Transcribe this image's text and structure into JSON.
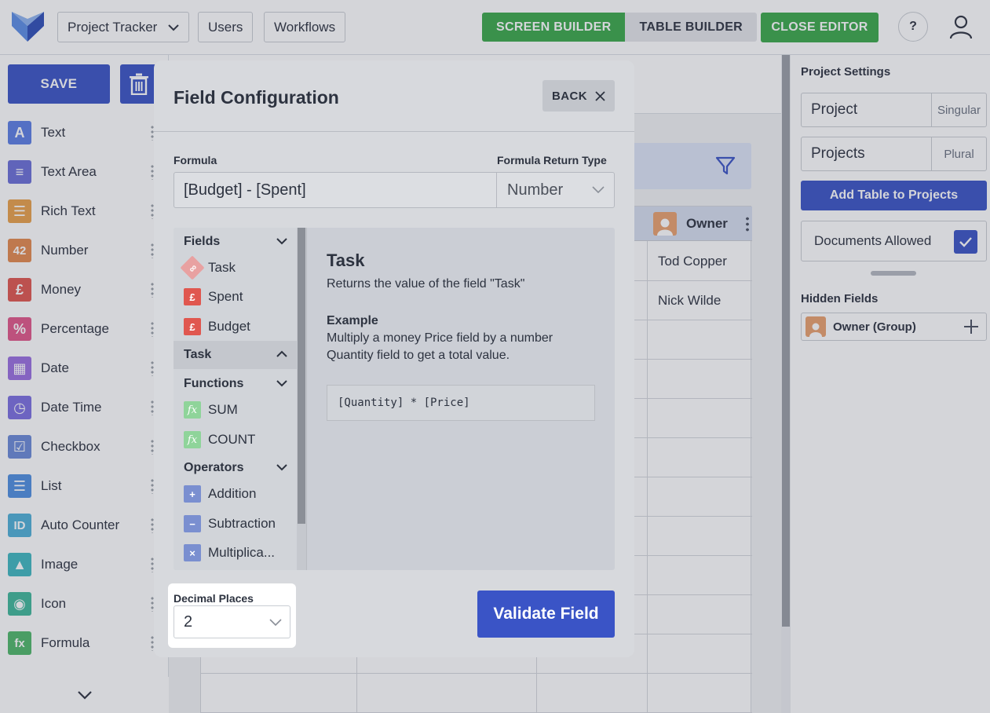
{
  "topbar": {
    "app_selector": "Project Tracker",
    "users_label": "Users",
    "workflows_label": "Workflows",
    "screen_builder_label": "SCREEN BUILDER",
    "table_builder_label": "TABLE BUILDER",
    "close_editor_label": "CLOSE EDITOR",
    "help_label": "?"
  },
  "palette": {
    "save_label": "SAVE",
    "items": [
      {
        "label": "Text",
        "icon": "text-icon",
        "glyph": "A",
        "color": "#5b7ee5"
      },
      {
        "label": "Text Area",
        "icon": "text-area-icon",
        "glyph": "≡",
        "color": "#6b6fd8"
      },
      {
        "label": "Rich Text",
        "icon": "rich-text-icon",
        "glyph": "☰",
        "color": "#e9a04a"
      },
      {
        "label": "Number",
        "icon": "number-icon",
        "glyph": "42",
        "color": "#e58a4e"
      },
      {
        "label": "Money",
        "icon": "money-icon",
        "glyph": "£",
        "color": "#e0574f"
      },
      {
        "label": "Percentage",
        "icon": "percentage-icon",
        "glyph": "%",
        "color": "#e2578a"
      },
      {
        "label": "Date",
        "icon": "date-icon",
        "glyph": "▦",
        "color": "#9a6fe0"
      },
      {
        "label": "Date Time",
        "icon": "date-time-icon",
        "glyph": "◷",
        "color": "#7b6fe0"
      },
      {
        "label": "Checkbox",
        "icon": "checkbox-icon",
        "glyph": "☑",
        "color": "#6b8ad8"
      },
      {
        "label": "List",
        "icon": "list-icon",
        "glyph": "☰",
        "color": "#4f8fe0"
      },
      {
        "label": "Auto Counter",
        "icon": "auto-counter-icon",
        "glyph": "ID",
        "color": "#4fb0d8"
      },
      {
        "label": "Image",
        "icon": "image-icon",
        "glyph": "▲",
        "color": "#3fb8c0"
      },
      {
        "label": "Icon",
        "icon": "icon-icon",
        "glyph": "◉",
        "color": "#3fb89a"
      },
      {
        "label": "Formula",
        "icon": "formula-icon",
        "glyph": "fx",
        "color": "#4fb86a"
      }
    ]
  },
  "canvas": {
    "owner_column": "Owner",
    "rows": [
      "Tod Copper",
      "Nick Wilde"
    ]
  },
  "settings": {
    "title": "Project Settings",
    "singular_value": "Project",
    "singular_suffix": "Singular",
    "plural_value": "Projects",
    "plural_suffix": "Plural",
    "add_table_label": "Add Table to Projects",
    "documents_label": "Documents Allowed",
    "hidden_fields_title": "Hidden Fields",
    "hidden_fields": [
      "Owner (Group)"
    ]
  },
  "modal": {
    "title": "Field Configuration",
    "back_label": "BACK",
    "formula_label": "Formula",
    "formula_value": "[Budget] - [Spent]",
    "return_type_label": "Formula Return Type",
    "return_type_value": "Number",
    "groups": {
      "fields": "Fields",
      "task": "Task",
      "functions": "Functions",
      "operators": "Operators"
    },
    "field_items": [
      {
        "label": "Task",
        "icon": "link-icon",
        "glyph": "🔗",
        "color": "#e8a1a1"
      },
      {
        "label": "Spent",
        "icon": "money-icon",
        "glyph": "£",
        "color": "#e0574f"
      },
      {
        "label": "Budget",
        "icon": "money-icon",
        "glyph": "£",
        "color": "#e0574f"
      }
    ],
    "function_items": [
      {
        "label": "SUM",
        "icon": "formula-icon",
        "glyph": "fx",
        "color": "#8fd49a"
      },
      {
        "label": "COUNT",
        "icon": "formula-icon",
        "glyph": "fx",
        "color": "#8fd49a"
      }
    ],
    "operator_items": [
      {
        "label": "Addition",
        "icon": "plus-icon",
        "glyph": "+",
        "color": "#7a8fd0"
      },
      {
        "label": "Subtraction",
        "icon": "minus-icon",
        "glyph": "−",
        "color": "#7a8fd0"
      },
      {
        "label": "Multiplica...",
        "icon": "multiply-icon",
        "glyph": "×",
        "color": "#7a8fd0"
      }
    ],
    "detail_title": "Task",
    "detail_desc": "Returns the value of the field \"Task\"",
    "example_label": "Example",
    "example_line1": "Multiply a money Price field by a number",
    "example_line2": "Quantity field to get a total value.",
    "example_code": "[Quantity] * [Price]",
    "decimal_label": "Decimal Places",
    "decimal_value": "2",
    "validate_label": "Validate Field"
  }
}
